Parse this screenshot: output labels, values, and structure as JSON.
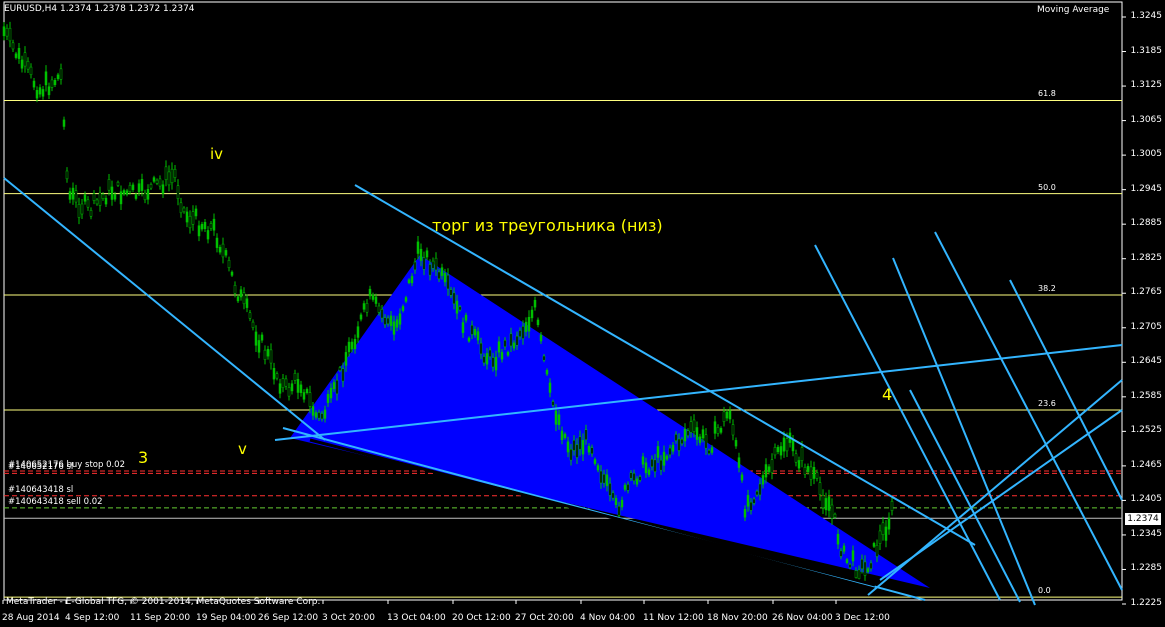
{
  "header": {
    "symbol_line": "EURUSD,H4  1.2374 1.2378 1.2372 1.2374",
    "indicator": "Moving Average",
    "copyright": "MetaTrader - E-Global TFG, © 2001-2014, MetaQuotes Software Corp."
  },
  "colors": {
    "background": "#000000",
    "candles": "#00c000",
    "fib_lines": "#ffff80",
    "triangle_fill": "#0000ff",
    "trend_lines": "#33b5ff",
    "annotation": "#ffff00",
    "order_red": "#ff3030",
    "order_green": "#66cc33",
    "axis": "#ffffff"
  },
  "price_axis": {
    "ticks": [
      "1.3245",
      "1.3185",
      "1.3125",
      "1.3065",
      "1.3005",
      "1.2945",
      "1.2885",
      "1.2825",
      "1.2765",
      "1.2705",
      "1.2645",
      "1.2585",
      "1.2525",
      "1.2465",
      "1.2405",
      "1.2345",
      "1.2285",
      "1.2225"
    ],
    "current_price": "1.2374"
  },
  "time_axis": {
    "ticks": [
      "28 Aug 2014",
      "4 Sep 12:00",
      "11 Sep 20:00",
      "19 Sep 04:00",
      "26 Sep 12:00",
      "3 Oct 20:00",
      "13 Oct 04:00",
      "20 Oct 12:00",
      "27 Oct 20:00",
      "4 Nov 04:00",
      "11 Nov 12:00",
      "18 Nov 20:00",
      "26 Nov 04:00",
      "3 Dec 12:00"
    ]
  },
  "fibonacci": [
    {
      "label": "61.8",
      "price": 1.31
    },
    {
      "label": "50.0",
      "price": 1.2938
    },
    {
      "label": "38.2",
      "price": 1.2762
    },
    {
      "label": "23.6",
      "price": 1.2562
    },
    {
      "label": "0.0",
      "price": 1.2237
    }
  ],
  "orders": [
    {
      "label": "#140652176 buy stop 0.02",
      "price": 1.2456,
      "color": "red"
    },
    {
      "label": "#140652176 sl",
      "price": 1.2452,
      "color": "red"
    },
    {
      "label": "#140643418 sl",
      "price": 1.2413,
      "color": "red"
    },
    {
      "label": "#140643418 sell 0.02",
      "price": 1.2392,
      "color": "green"
    }
  ],
  "annotations": {
    "triangle_note": "торг из треугольника (низ)",
    "wave_iv": "iv",
    "wave_v": "v",
    "wave_3": "3",
    "wave_4": "4"
  }
}
